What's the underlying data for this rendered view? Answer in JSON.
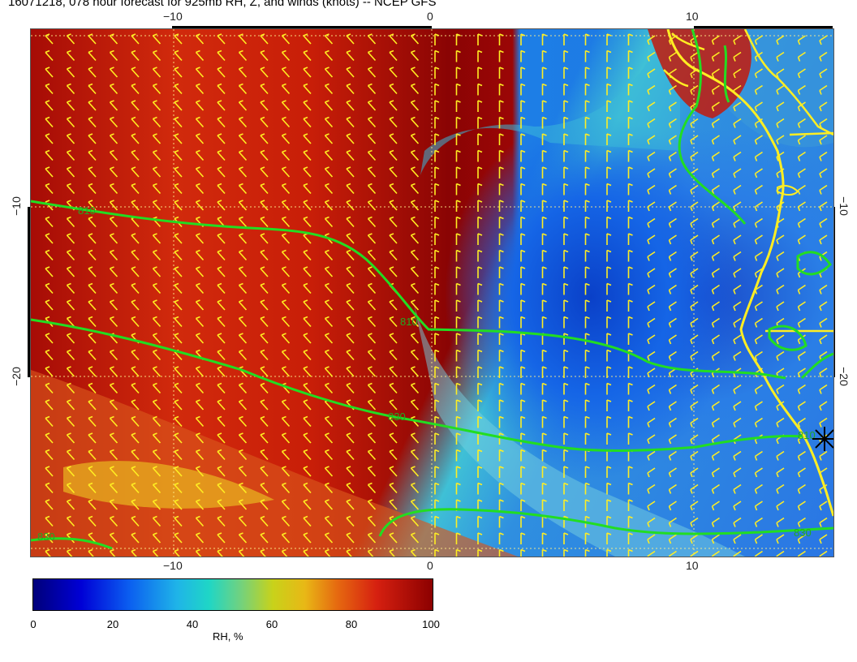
{
  "title": "16071218, 078 hour forecast for 925mb RH, Z, and winds (knots) -- NCEP GFS",
  "axes": {
    "top_ticks": [
      "−10",
      "0",
      "10"
    ],
    "bottom_ticks": [
      "−10",
      "0",
      "10"
    ],
    "left_ticks": [
      "−10",
      "−20"
    ],
    "right_ticks": [
      "−10",
      "−20"
    ]
  },
  "contours": {
    "labels": [
      "810",
      "810",
      "830",
      "830",
      "810",
      "830"
    ],
    "color": "#22dd22"
  },
  "colorbar": {
    "ticks": [
      "0",
      "20",
      "40",
      "60",
      "80",
      "100"
    ],
    "label": "RH, %"
  },
  "colors": {
    "coastline": "#ffee22",
    "wind_barbs": "#ffee22",
    "grid": "#ffee88"
  },
  "icons": [
    "station-marker-icon"
  ]
}
